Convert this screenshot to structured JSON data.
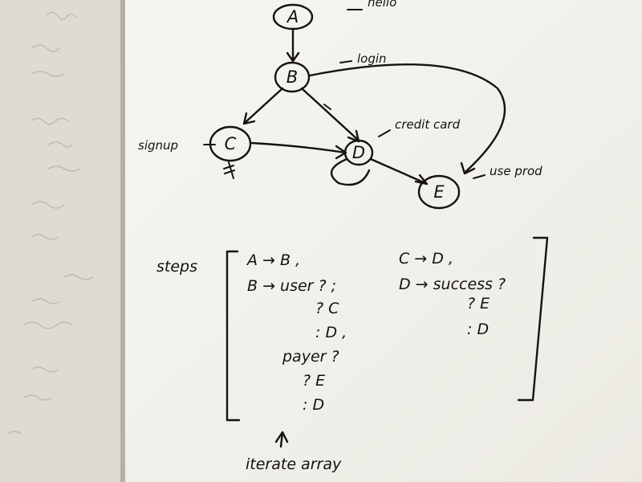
{
  "diagram": {
    "nodes": [
      {
        "id": "A",
        "label": "A",
        "note": "hello"
      },
      {
        "id": "B",
        "label": "B",
        "note": "login"
      },
      {
        "id": "C",
        "label": "C",
        "note": "signup"
      },
      {
        "id": "D",
        "label": "D",
        "note": "credit card"
      },
      {
        "id": "E",
        "label": "E",
        "note": "use prod"
      }
    ]
  },
  "steps": {
    "heading": "steps",
    "left_column": [
      "A → B ,",
      "B → user ? ;",
      "? C",
      ": D ,",
      "payer ?",
      "? E",
      ": D"
    ],
    "right_column": [
      "C → D ,",
      "D → success ?",
      "? E",
      ": D"
    ]
  },
  "footnote": "iterate array",
  "colors": {
    "paper": "#f3f2ec",
    "ink": "#15120f",
    "background": "#6f6a5f"
  }
}
